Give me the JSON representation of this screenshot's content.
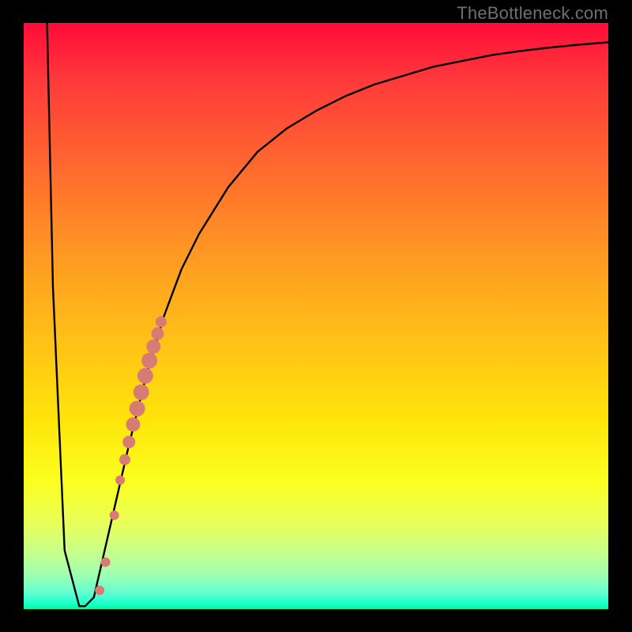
{
  "watermark": "TheBottleneck.com",
  "colors": {
    "frame": "#000000",
    "curve": "#000000",
    "marker_fill": "#d97b75",
    "marker_stroke": "#b85a55"
  },
  "chart_data": {
    "type": "line",
    "title": "",
    "xlabel": "",
    "ylabel": "",
    "xlim": [
      0,
      100
    ],
    "ylim": [
      0,
      100
    ],
    "grid": false,
    "series": [
      {
        "name": "bottleneck-curve",
        "x": [
          4.0,
          5.0,
          7.0,
          9.5,
          10.5,
          12.0,
          15.0,
          18.0,
          21.0,
          24.0,
          27.0,
          30.0,
          35.0,
          40.0,
          45.0,
          50.0,
          55.0,
          60.0,
          65.0,
          70.0,
          75.0,
          80.0,
          85.0,
          90.0,
          95.0,
          100.0
        ],
        "values": [
          100,
          55.0,
          10.0,
          0.5,
          0.5,
          2.0,
          15.0,
          28.0,
          40.0,
          50.0,
          58.0,
          64.0,
          72.0,
          78.0,
          82.0,
          85.0,
          87.5,
          89.5,
          91.0,
          92.5,
          93.5,
          94.5,
          95.2,
          95.8,
          96.3,
          96.7
        ]
      }
    ],
    "markers": [
      {
        "x": 13.0,
        "y": 3.2,
        "r": 6
      },
      {
        "x": 14.0,
        "y": 8.0,
        "r": 6
      },
      {
        "x": 15.5,
        "y": 16.0,
        "r": 6
      },
      {
        "x": 16.5,
        "y": 22.0,
        "r": 6
      },
      {
        "x": 17.3,
        "y": 25.5,
        "r": 7
      },
      {
        "x": 18.0,
        "y": 28.5,
        "r": 8
      },
      {
        "x": 18.7,
        "y": 31.5,
        "r": 9
      },
      {
        "x": 19.4,
        "y": 34.2,
        "r": 10
      },
      {
        "x": 20.1,
        "y": 37.0,
        "r": 10
      },
      {
        "x": 20.8,
        "y": 39.8,
        "r": 10
      },
      {
        "x": 21.5,
        "y": 42.4,
        "r": 10
      },
      {
        "x": 22.2,
        "y": 44.8,
        "r": 9
      },
      {
        "x": 22.9,
        "y": 47.0,
        "r": 8
      },
      {
        "x": 23.5,
        "y": 49.0,
        "r": 7
      }
    ]
  }
}
